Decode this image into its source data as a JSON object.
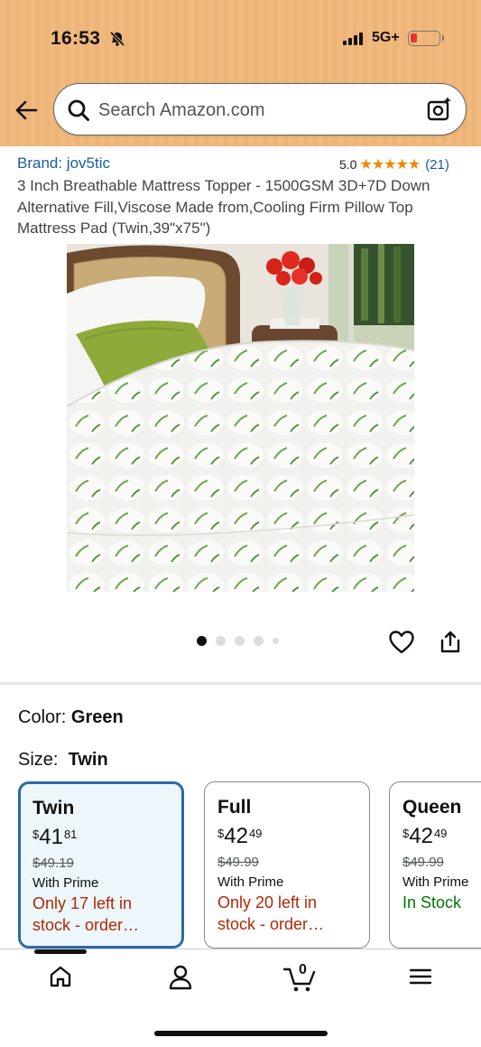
{
  "status_bar": {
    "time": "16:53",
    "network": "5G+"
  },
  "search": {
    "placeholder": "Search Amazon.com"
  },
  "product": {
    "brand": "Brand: jov5tic",
    "rating": "5.0",
    "stars": "★★★★★",
    "review_count": "(21)",
    "title": "3 Inch Breathable Mattress Topper - 1500GSM 3D+7D Down Alternative Fill,Viscose Made from,Cooling Firm Pillow Top Mattress Pad (Twin,39\"x75\")"
  },
  "carousel": {
    "total": 5,
    "active": 1
  },
  "variants": {
    "color_label": "Color:",
    "color_value": "Green",
    "size_label": "Size:",
    "size_value": "Twin",
    "sizes": [
      {
        "name": "Twin",
        "currency": "$",
        "price_whole": "41",
        "price_fraction": "81",
        "list_price": "$49.19",
        "prime": "With Prime",
        "stock": "Only 17 left in stock - order…"
      },
      {
        "name": "Full",
        "currency": "$",
        "price_whole": "42",
        "price_fraction": "49",
        "list_price": "$49.99",
        "prime": "With Prime",
        "stock": "Only 20 left in stock - order…"
      },
      {
        "name": "Queen",
        "currency": "$",
        "price_whole": "42",
        "price_fraction": "49",
        "list_price": "$49.99",
        "prime": "With Prime",
        "stock": "In Stock"
      }
    ]
  },
  "cart": {
    "count": "0"
  },
  "colors": {
    "header_bg": "#f0b97e",
    "link": "#1a5c9e",
    "star": "#f08804",
    "low_stock": "#b12704",
    "in_stock": "#007600",
    "selected_border": "#2a6aa5"
  }
}
